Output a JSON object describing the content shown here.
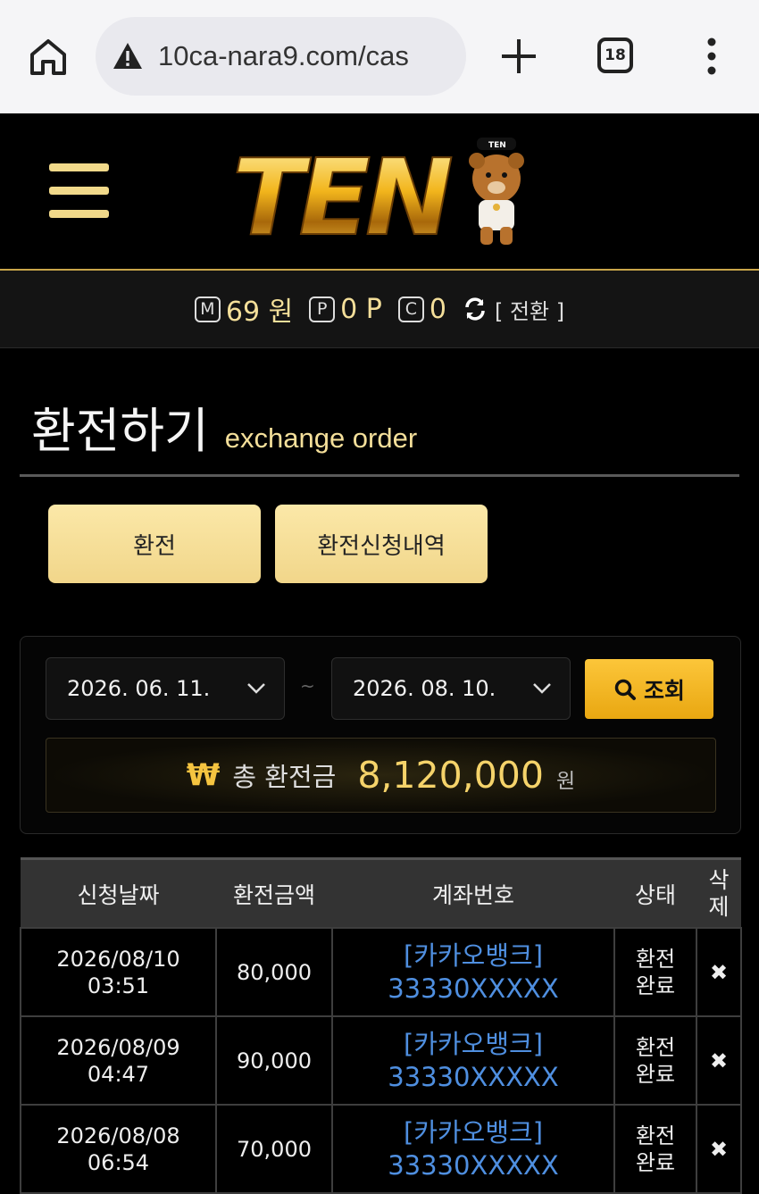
{
  "browser": {
    "url": "10ca-nara9.com/cas",
    "tab_count": "18"
  },
  "header": {
    "logo_text": "TEN",
    "mascot_hat_text": "TEN"
  },
  "balance": {
    "m_icon": "M",
    "m_value": "69 원",
    "p_icon": "P",
    "p_value": "0 P",
    "c_icon": "C",
    "c_value": "0",
    "switch_label": "[ 전환 ]"
  },
  "page": {
    "title": "환전하기",
    "subtitle": "exchange order"
  },
  "tabs": {
    "exchange": "환전",
    "history": "환전신청내역"
  },
  "filter": {
    "date_from": "2026. 06. 11.",
    "date_to": "2026. 08. 10.",
    "separator": "~",
    "search_label": "조회"
  },
  "total": {
    "currency_symbol": "₩",
    "label": "총 환전금",
    "amount": "8,120,000",
    "unit": "원"
  },
  "table": {
    "headers": {
      "date": "신청날짜",
      "amount": "환전금액",
      "account": "계좌번호",
      "status": "상태",
      "delete_1": "삭",
      "delete_2": "제"
    },
    "rows": [
      {
        "date": "2026/08/10",
        "time": "03:51",
        "amount": "80,000",
        "bank": "[카카오뱅크]",
        "account": "33330XXXXX",
        "status_1": "환전",
        "status_2": "완료",
        "delete": "✖"
      },
      {
        "date": "2026/08/09",
        "time": "04:47",
        "amount": "90,000",
        "bank": "[카카오뱅크]",
        "account": "33330XXXXX",
        "status_1": "환전",
        "status_2": "완료",
        "delete": "✖"
      },
      {
        "date": "2026/08/08",
        "time": "06:54",
        "amount": "70,000",
        "bank": "[카카오뱅크]",
        "account": "33330XXXXX",
        "status_1": "환전",
        "status_2": "완료",
        "delete": "✖"
      }
    ]
  },
  "colors": {
    "gold": "#f4df9a",
    "link_blue": "#4f8fe0",
    "search_button": "#f5b622"
  }
}
